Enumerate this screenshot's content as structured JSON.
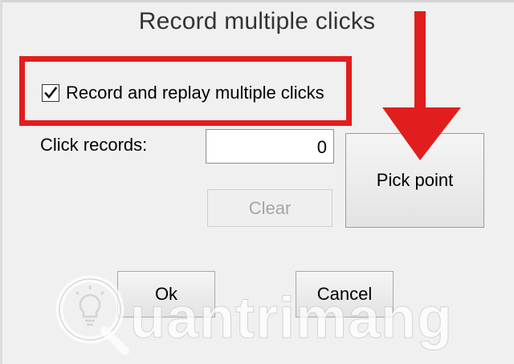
{
  "dialog": {
    "title": "Record multiple clicks"
  },
  "option": {
    "checkbox_label": "Record and replay multiple clicks",
    "checked": true
  },
  "records": {
    "label": "Click records:",
    "value": "0"
  },
  "buttons": {
    "clear": "Clear",
    "pick_point": "Pick point",
    "ok": "Ok",
    "cancel": "Cancel"
  },
  "watermark": {
    "text": "uantrimang",
    "logo_icon": "lightbulb-q-icon"
  },
  "annotation": {
    "arrow_icon": "arrow-down-icon",
    "highlight_color": "#e21d1d"
  },
  "colors": {
    "background": "#f0f0f0",
    "annotation_red": "#e21d1d",
    "disabled_text": "#a6a6a6"
  }
}
